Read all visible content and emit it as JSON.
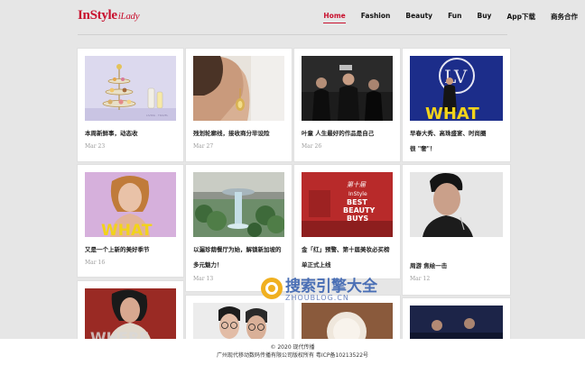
{
  "brand": {
    "main": "InStyle",
    "sub": "iLady"
  },
  "nav": [
    {
      "label": "Home",
      "active": true
    },
    {
      "label": "Fashion"
    },
    {
      "label": "Beauty"
    },
    {
      "label": "Fun"
    },
    {
      "label": "Buy"
    },
    {
      "label": "App下载"
    },
    {
      "label": "商务合作"
    }
  ],
  "cards": [
    {
      "title": "本周新鲜事，动态收",
      "date": "Mar 23",
      "image": "afternoon-tea-tower"
    },
    {
      "title": "残划轮廓线，接收商分毕设险",
      "date": "Mar 27",
      "image": "earring-portrait"
    },
    {
      "title": "叶童 人生最好的作品是自己",
      "date": "Mar 26",
      "image": "dark-fashion-group"
    },
    {
      "title": "早春大秀、高珠盛宴、时尚圈",
      "title2": "很 \"奢\"！",
      "date": "",
      "image": "lv-what"
    },
    {
      "title": "又是一个上新的美好季节",
      "date": "Mar 16",
      "image": "what-portrait"
    },
    {
      "title": "以漏珍荫餐厅为始，解锁新加坡的",
      "title2": "多元魅力！",
      "date": "Mar 13",
      "image": "jewel-waterfall"
    },
    {
      "title": "金「红」预警、第十届美妆必买榜",
      "title2": "单正式上线",
      "date": "",
      "image": "best-beauty-buys"
    },
    {
      "title": "周游 焦绘一击",
      "date": "Mar 12",
      "image": "man-portrait"
    },
    {
      "title": "",
      "date": "",
      "image": "where-portrait"
    },
    {
      "title": "",
      "date": "",
      "image": "glasses-portrait"
    },
    {
      "title": "",
      "date": "",
      "image": "white-product"
    },
    {
      "title": "",
      "date": "",
      "image": "dark-blue-scene"
    }
  ],
  "footer": {
    "line1": "© 2020 现代传播",
    "line2": "广州现代移动数码传播有限公司版权所有 粤ICP备10213522号"
  },
  "watermark": {
    "main": "搜索引擎大全",
    "url": "ZHOUBLOG.CN"
  }
}
